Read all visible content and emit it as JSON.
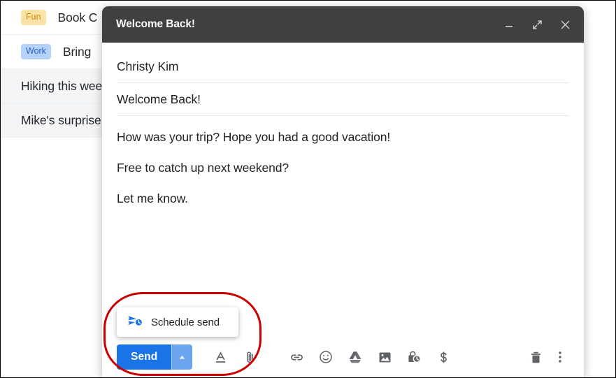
{
  "mail_list": {
    "rows": [
      {
        "badge": "Fun",
        "badge_type": "fun",
        "subject": "Book C"
      },
      {
        "badge": "Work",
        "badge_type": "work",
        "subject": "Bring"
      },
      {
        "badge": "",
        "badge_type": "",
        "subject": "Hiking this wee"
      },
      {
        "badge": "",
        "badge_type": "",
        "subject": "Mike's surprise"
      }
    ]
  },
  "compose": {
    "title": "Welcome Back!",
    "window_controls": {
      "minimize": "minimize-icon",
      "expand": "expand-icon",
      "close": "close-icon"
    },
    "to": "Christy Kim",
    "subject": "Welcome Back!",
    "body": [
      "How was your trip? Hope you had a good vacation!",
      "Free to catch up next weekend?",
      "Let me know."
    ],
    "toolbar": {
      "send_label": "Send",
      "send_dropdown": "chevron-up-icon",
      "icons": [
        {
          "name": "format-options-icon",
          "title": "Formatting options"
        },
        {
          "name": "attach-file-icon",
          "title": "Attach files"
        },
        {
          "name": "insert-link-icon",
          "title": "Insert link"
        },
        {
          "name": "insert-emoji-icon",
          "title": "Insert emoji"
        },
        {
          "name": "google-drive-icon",
          "title": "Insert files using Drive"
        },
        {
          "name": "insert-photo-icon",
          "title": "Insert photo"
        },
        {
          "name": "confidential-mode-icon",
          "title": "Toggle confidential mode"
        },
        {
          "name": "insert-money-icon",
          "title": "Send money"
        }
      ],
      "discard_icon": "trash-icon",
      "more_options_icon": "more-options-icon"
    },
    "schedule_popup": {
      "icon": "schedule-send-icon",
      "label": "Schedule send"
    }
  },
  "annotation": {
    "shape": "oval-highlight",
    "color": "#cc0000"
  },
  "colors": {
    "header_bar": "#404040",
    "send_blue": "#1b73e8",
    "send_dropdown_blue": "#6ba4ef",
    "badge_fun_bg": "#fbe2a7",
    "badge_fun_text": "#d4890b",
    "badge_work_bg": "#b5d3f8",
    "badge_work_text": "#2a62c4",
    "icon_gray": "#5f6368",
    "annotation_red": "#cc0000"
  }
}
